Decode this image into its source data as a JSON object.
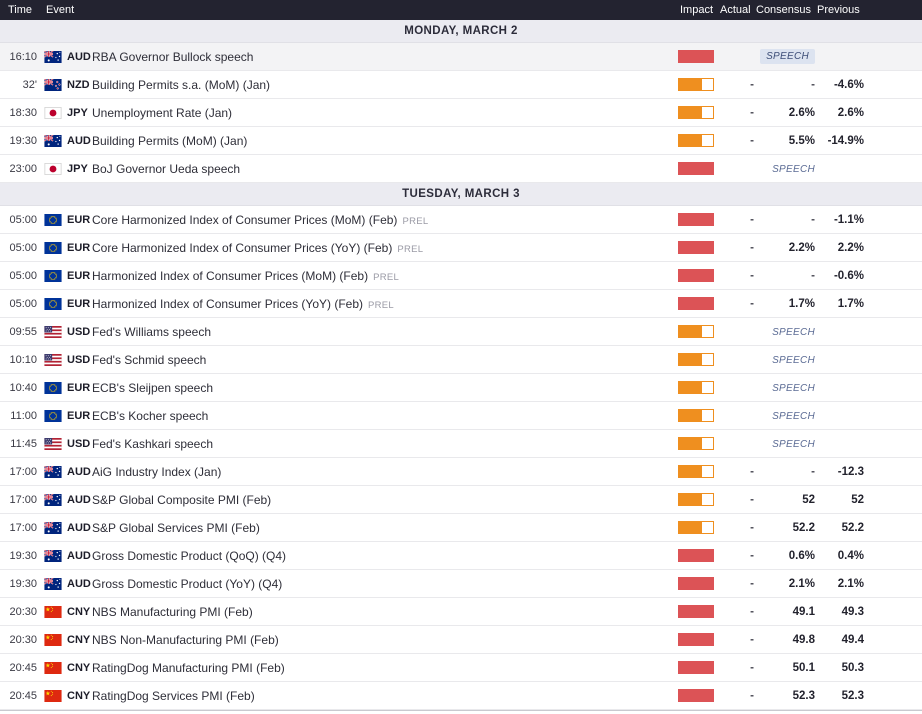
{
  "header": {
    "columns": {
      "time": "Time",
      "event": "Event",
      "impact": "Impact",
      "actual": "Actual",
      "consensus": "Consensus",
      "previous": "Previous"
    }
  },
  "strings": {
    "speech_label": "SPEECH",
    "prel_label": "PREL",
    "dash": "-"
  },
  "colors": {
    "impact_high": "#dc5356",
    "impact_medium": "#ef8f1f",
    "header_bg": "#232330",
    "day_header_bg": "#ebebf1",
    "highlight_row_bg": "#f3f3f5",
    "speech_badge_bg": "#dce3f0"
  },
  "sections": [
    {
      "day_label": "MONDAY, MARCH 2",
      "rows": [
        {
          "time": "16:10",
          "currency": "AUD",
          "event": "RBA Governor Bullock speech",
          "prel": false,
          "impact": "high",
          "actual": "",
          "consensus": "",
          "previous": "",
          "speech": "badge",
          "highlighted": true
        },
        {
          "time": "32'",
          "currency": "NZD",
          "event": "Building Permits s.a. (MoM) (Jan)",
          "prel": false,
          "impact": "medium",
          "actual": "-",
          "consensus": "-",
          "previous": "-4.6%",
          "speech": null,
          "highlighted": false
        },
        {
          "time": "18:30",
          "currency": "JPY",
          "event": "Unemployment Rate (Jan)",
          "prel": false,
          "impact": "medium",
          "actual": "-",
          "consensus": "2.6%",
          "previous": "2.6%",
          "speech": null,
          "highlighted": false
        },
        {
          "time": "19:30",
          "currency": "AUD",
          "event": "Building Permits (MoM) (Jan)",
          "prel": false,
          "impact": "medium",
          "actual": "-",
          "consensus": "5.5%",
          "previous": "-14.9%",
          "speech": null,
          "highlighted": false
        },
        {
          "time": "23:00",
          "currency": "JPY",
          "event": "BoJ Governor Ueda speech",
          "prel": false,
          "impact": "high",
          "actual": "",
          "consensus": "",
          "previous": "",
          "speech": "text",
          "highlighted": false
        }
      ]
    },
    {
      "day_label": "TUESDAY, MARCH 3",
      "rows": [
        {
          "time": "05:00",
          "currency": "EUR",
          "event": "Core Harmonized Index of Consumer Prices (MoM) (Feb)",
          "prel": true,
          "impact": "high",
          "actual": "-",
          "consensus": "-",
          "previous": "-1.1%",
          "speech": null,
          "highlighted": false
        },
        {
          "time": "05:00",
          "currency": "EUR",
          "event": "Core Harmonized Index of Consumer Prices (YoY) (Feb)",
          "prel": true,
          "impact": "high",
          "actual": "-",
          "consensus": "2.2%",
          "previous": "2.2%",
          "speech": null,
          "highlighted": false
        },
        {
          "time": "05:00",
          "currency": "EUR",
          "event": "Harmonized Index of Consumer Prices (MoM) (Feb)",
          "prel": true,
          "impact": "high",
          "actual": "-",
          "consensus": "-",
          "previous": "-0.6%",
          "speech": null,
          "highlighted": false
        },
        {
          "time": "05:00",
          "currency": "EUR",
          "event": "Harmonized Index of Consumer Prices (YoY) (Feb)",
          "prel": true,
          "impact": "high",
          "actual": "-",
          "consensus": "1.7%",
          "previous": "1.7%",
          "speech": null,
          "highlighted": false
        },
        {
          "time": "09:55",
          "currency": "USD",
          "event": "Fed's Williams speech",
          "prel": false,
          "impact": "medium",
          "actual": "",
          "consensus": "",
          "previous": "",
          "speech": "text",
          "highlighted": false
        },
        {
          "time": "10:10",
          "currency": "USD",
          "event": "Fed's Schmid speech",
          "prel": false,
          "impact": "medium",
          "actual": "",
          "consensus": "",
          "previous": "",
          "speech": "text",
          "highlighted": false
        },
        {
          "time": "10:40",
          "currency": "EUR",
          "event": "ECB's Sleijpen speech",
          "prel": false,
          "impact": "medium",
          "actual": "",
          "consensus": "",
          "previous": "",
          "speech": "text",
          "highlighted": false
        },
        {
          "time": "11:00",
          "currency": "EUR",
          "event": "ECB's Kocher speech",
          "prel": false,
          "impact": "medium",
          "actual": "",
          "consensus": "",
          "previous": "",
          "speech": "text",
          "highlighted": false
        },
        {
          "time": "11:45",
          "currency": "USD",
          "event": "Fed's Kashkari speech",
          "prel": false,
          "impact": "medium",
          "actual": "",
          "consensus": "",
          "previous": "",
          "speech": "text",
          "highlighted": false
        },
        {
          "time": "17:00",
          "currency": "AUD",
          "event": "AiG Industry Index (Jan)",
          "prel": false,
          "impact": "medium",
          "actual": "-",
          "consensus": "-",
          "previous": "-12.3",
          "speech": null,
          "highlighted": false
        },
        {
          "time": "17:00",
          "currency": "AUD",
          "event": "S&P Global Composite PMI (Feb)",
          "prel": false,
          "impact": "medium",
          "actual": "-",
          "consensus": "52",
          "previous": "52",
          "speech": null,
          "highlighted": false
        },
        {
          "time": "17:00",
          "currency": "AUD",
          "event": "S&P Global Services PMI (Feb)",
          "prel": false,
          "impact": "medium",
          "actual": "-",
          "consensus": "52.2",
          "previous": "52.2",
          "speech": null,
          "highlighted": false
        },
        {
          "time": "19:30",
          "currency": "AUD",
          "event": "Gross Domestic Product (QoQ) (Q4)",
          "prel": false,
          "impact": "high",
          "actual": "-",
          "consensus": "0.6%",
          "previous": "0.4%",
          "speech": null,
          "highlighted": false
        },
        {
          "time": "19:30",
          "currency": "AUD",
          "event": "Gross Domestic Product (YoY) (Q4)",
          "prel": false,
          "impact": "high",
          "actual": "-",
          "consensus": "2.1%",
          "previous": "2.1%",
          "speech": null,
          "highlighted": false
        },
        {
          "time": "20:30",
          "currency": "CNY",
          "event": "NBS Manufacturing PMI (Feb)",
          "prel": false,
          "impact": "high",
          "actual": "-",
          "consensus": "49.1",
          "previous": "49.3",
          "speech": null,
          "highlighted": false
        },
        {
          "time": "20:30",
          "currency": "CNY",
          "event": "NBS Non-Manufacturing PMI (Feb)",
          "prel": false,
          "impact": "high",
          "actual": "-",
          "consensus": "49.8",
          "previous": "49.4",
          "speech": null,
          "highlighted": false
        },
        {
          "time": "20:45",
          "currency": "CNY",
          "event": "RatingDog Manufacturing PMI (Feb)",
          "prel": false,
          "impact": "high",
          "actual": "-",
          "consensus": "50.1",
          "previous": "50.3",
          "speech": null,
          "highlighted": false
        },
        {
          "time": "20:45",
          "currency": "CNY",
          "event": "RatingDog Services PMI (Feb)",
          "prel": false,
          "impact": "high",
          "actual": "-",
          "consensus": "52.3",
          "previous": "52.3",
          "speech": null,
          "highlighted": false
        }
      ]
    }
  ]
}
